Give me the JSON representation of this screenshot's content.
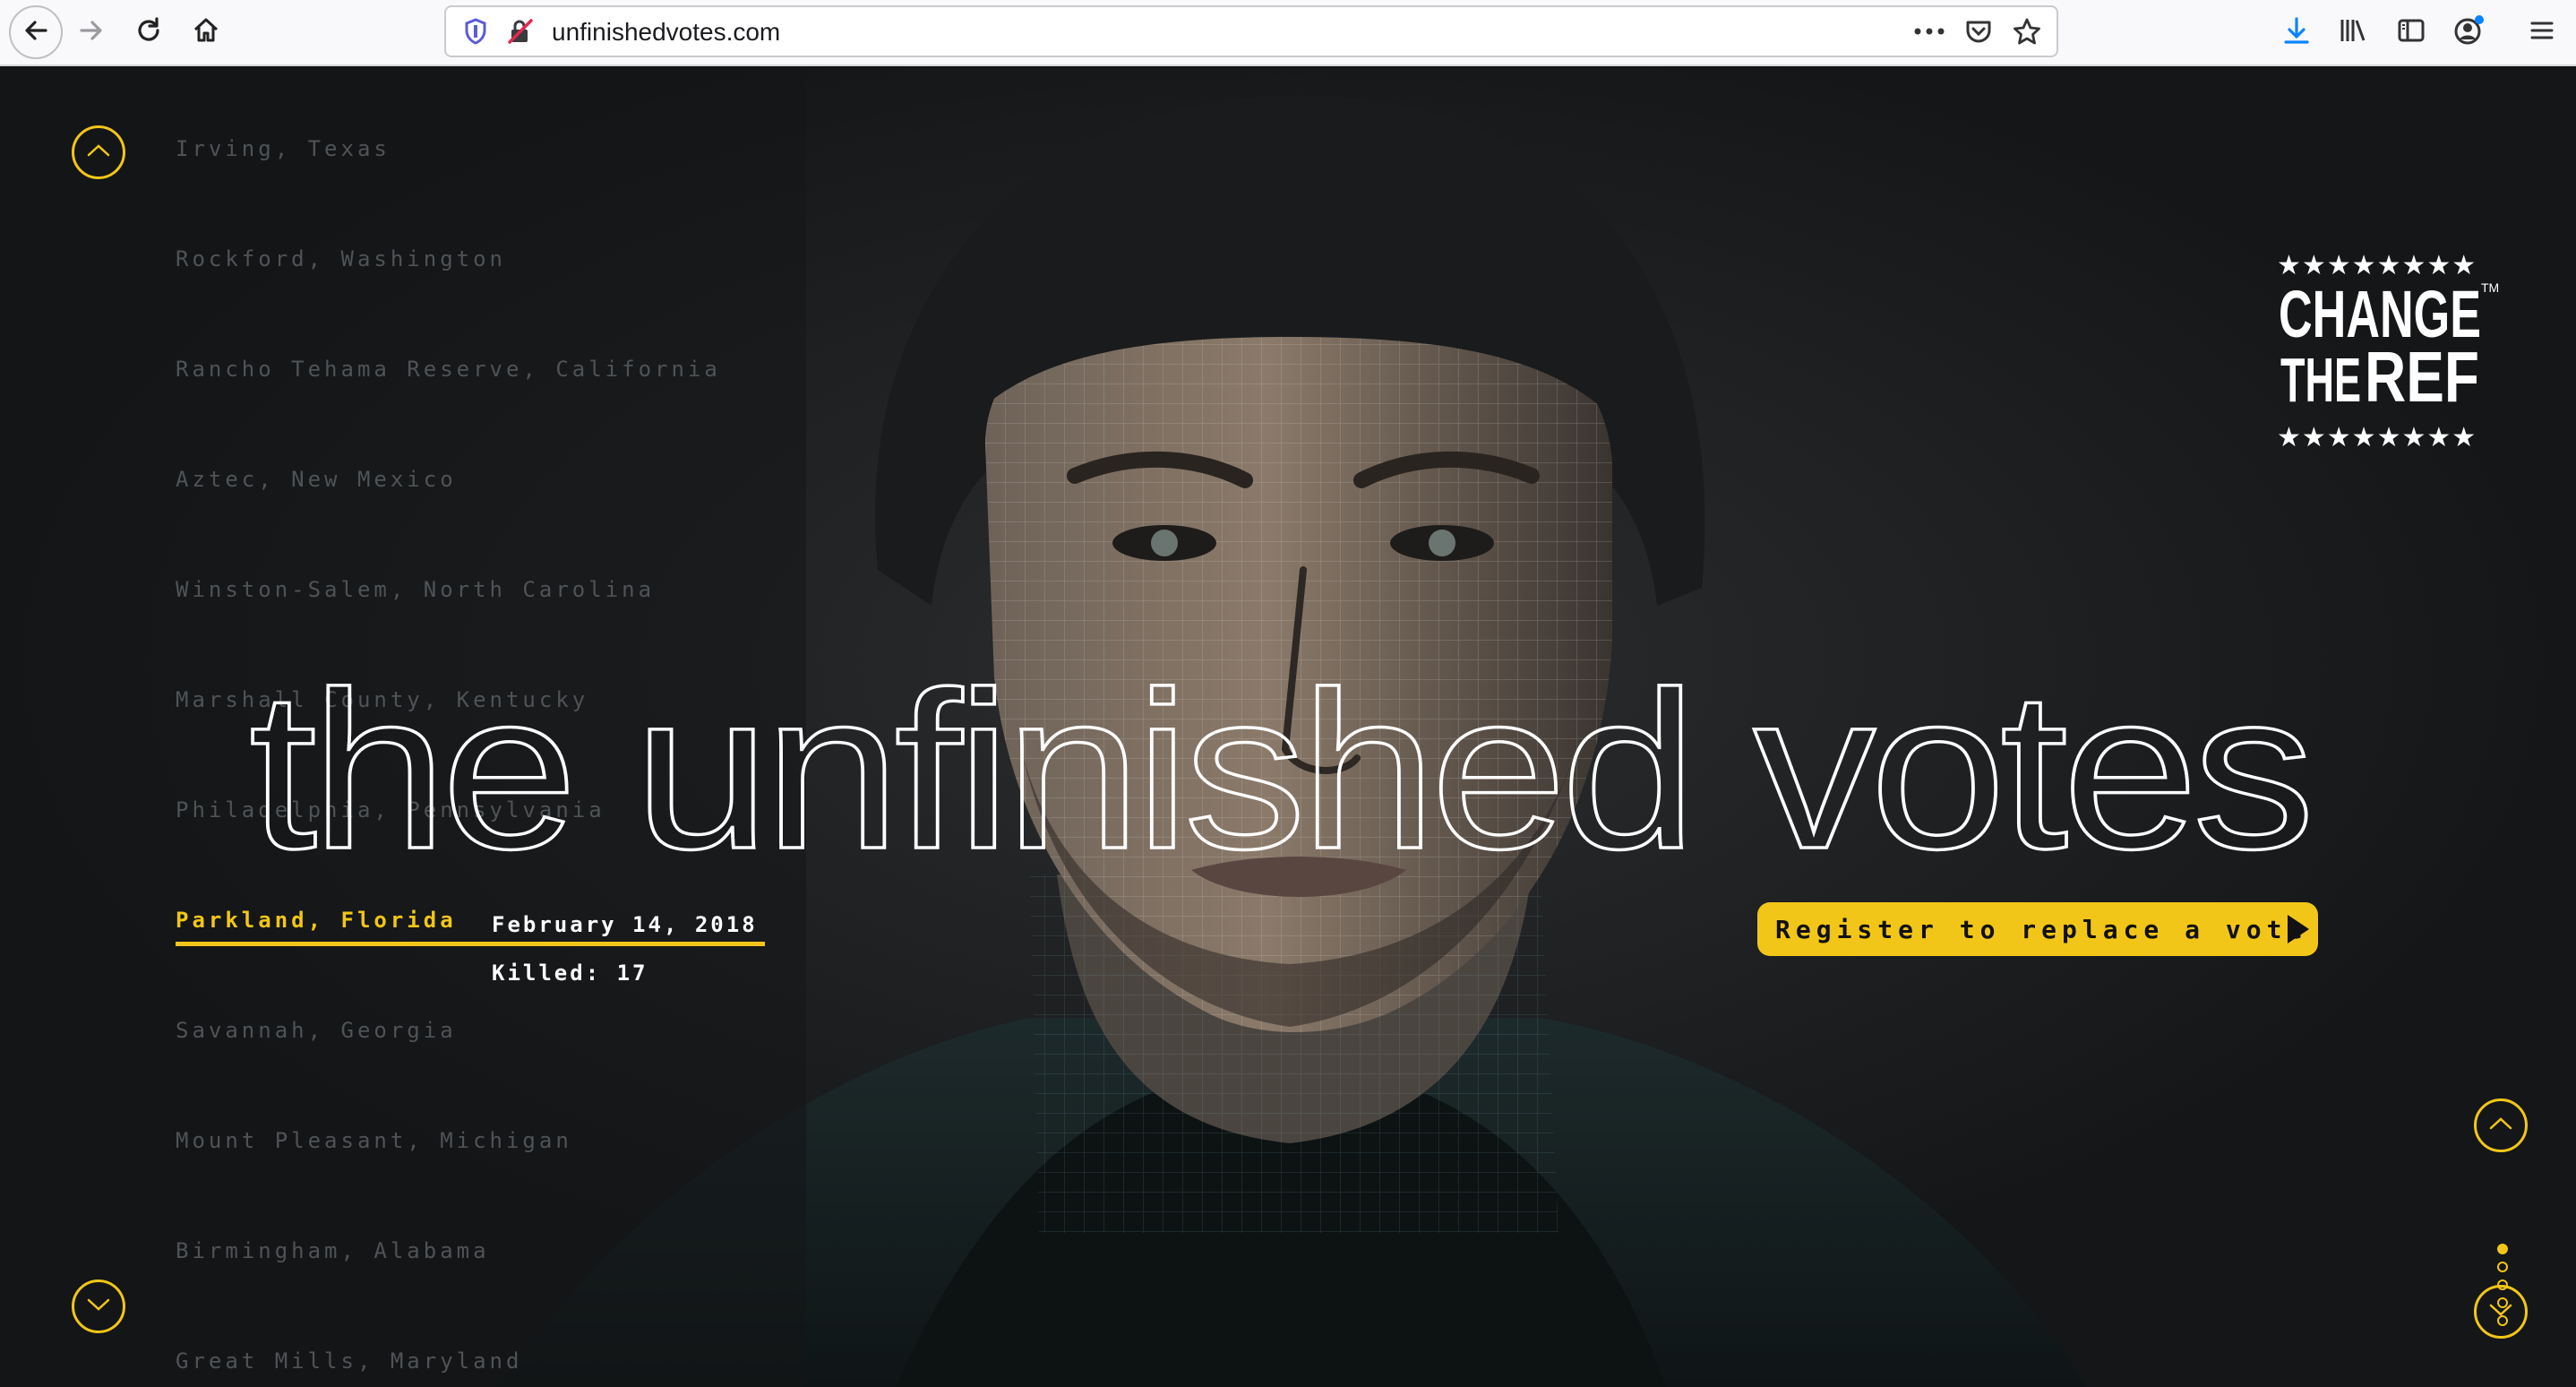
{
  "browser": {
    "url": "unfinishedvotes.com",
    "icons": [
      "back-icon",
      "forward-icon",
      "reload-icon",
      "home-icon",
      "tracking-shield-icon",
      "insecure-lock-icon",
      "page-actions-icon",
      "pocket-icon",
      "bookmark-star-icon",
      "downloads-icon",
      "library-icon",
      "sidebar-icon",
      "account-icon",
      "menu-icon"
    ]
  },
  "cities": [
    "Irving, Texas",
    "Rockford, Washington",
    "Rancho Tehama Reserve, California",
    "Aztec, New Mexico",
    "Winston-Salem, North Carolina",
    "Marshall County, Kentucky",
    "Philadelphia, Pennsylvania",
    "Parkland, Florida",
    "Savannah, Georgia",
    "Mount Pleasant, Michigan",
    "Birmingham, Alabama",
    "Great Mills, Maryland"
  ],
  "active_city_index": 7,
  "event": {
    "date": "February 14, 2018",
    "killed_label": "Killed: 17"
  },
  "headline": "the unfinished votes",
  "cta": {
    "label": "Register to replace a vote"
  },
  "logo": {
    "line1": "CHANGE",
    "line2": "THE",
    "line3": "REF",
    "tm": "TM"
  },
  "slides": {
    "total": 5,
    "current": 1
  },
  "colors": {
    "accent": "#f2c618",
    "background": "#141618",
    "inactive_text": "#4f5356"
  }
}
